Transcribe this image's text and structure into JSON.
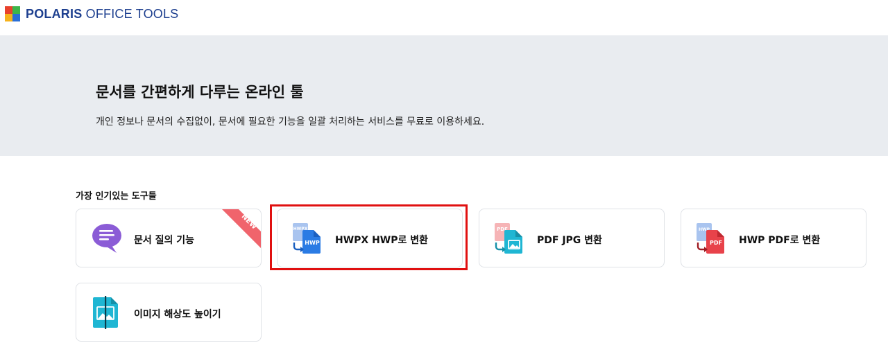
{
  "header": {
    "logo_bold": "POLARIS",
    "logo_rest": " OFFICE TOOLS",
    "logo_colors": [
      "#e8412c",
      "#3db54a",
      "#f6b21b",
      "#2a6fd6"
    ]
  },
  "hero": {
    "title": "문서를 간편하게 다루는 온라인 툴",
    "subtitle": "개인 정보나 문서의 수집없이, 문서에 필요한 기능을 일괄 처리하는 서비스를 무료로 이용하세요."
  },
  "section": {
    "title": "가장 인기있는 도구들"
  },
  "tools": [
    {
      "label": "문서 질의 기능",
      "icon": "chat-bubble-icon",
      "badge": "NEW",
      "color": "#8b5cd6"
    },
    {
      "label": "HWPX HWP로 변환",
      "icon": "hwpx-to-hwp-icon",
      "src_tag": "HWPX",
      "dst_tag": "HWP",
      "color": "#2a7be4"
    },
    {
      "label": "PDF JPG 변환",
      "icon": "pdf-to-jpg-icon",
      "src_tag": "PDF",
      "color": "#1fb6d3"
    },
    {
      "label": "HWP PDF로 변환",
      "icon": "hwp-to-pdf-icon",
      "src_tag": "HWP",
      "dst_tag": "PDF",
      "color": "#e8424a"
    },
    {
      "label": "이미지 해상도 높이기",
      "icon": "image-upscale-icon",
      "color": "#1fb6d3"
    }
  ],
  "highlight_color": "#e01010",
  "badge_color": "#f0646c"
}
